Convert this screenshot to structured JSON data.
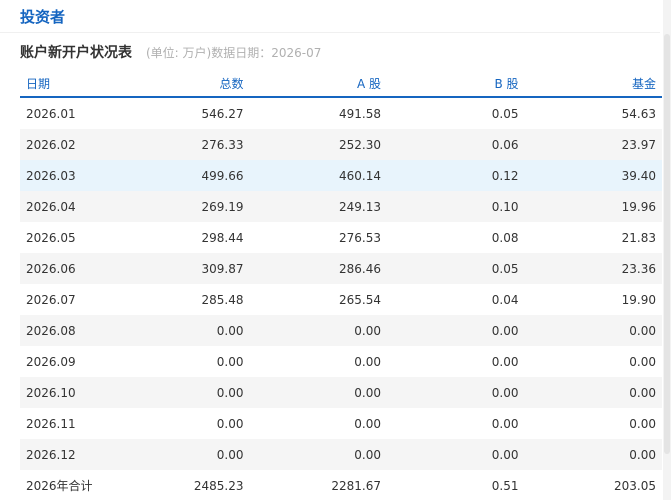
{
  "page": {
    "title": "投资者"
  },
  "section": {
    "title": "账户新开户状况表",
    "note": "(单位: 万户)数据日期：2026-07"
  },
  "table": {
    "headers": [
      "日期",
      "总数",
      "A 股",
      "B 股",
      "基金"
    ],
    "rows": [
      [
        "2026.01",
        "546.27",
        "491.58",
        "0.05",
        "54.63"
      ],
      [
        "2026.02",
        "276.33",
        "252.30",
        "0.06",
        "23.97"
      ],
      [
        "2026.03",
        "499.66",
        "460.14",
        "0.12",
        "39.40"
      ],
      [
        "2026.04",
        "269.19",
        "249.13",
        "0.10",
        "19.96"
      ],
      [
        "2026.05",
        "298.44",
        "276.53",
        "0.08",
        "21.83"
      ],
      [
        "2026.06",
        "309.87",
        "286.46",
        "0.05",
        "23.36"
      ],
      [
        "2026.07",
        "285.48",
        "265.54",
        "0.04",
        "19.90"
      ],
      [
        "2026.08",
        "0.00",
        "0.00",
        "0.00",
        "0.00"
      ],
      [
        "2026.09",
        "0.00",
        "0.00",
        "0.00",
        "0.00"
      ],
      [
        "2026.10",
        "0.00",
        "0.00",
        "0.00",
        "0.00"
      ],
      [
        "2026.11",
        "0.00",
        "0.00",
        "0.00",
        "0.00"
      ],
      [
        "2026.12",
        "0.00",
        "0.00",
        "0.00",
        "0.00"
      ],
      [
        "2026年合计",
        "2485.23",
        "2281.67",
        "0.51",
        "203.05"
      ]
    ]
  },
  "colors": {
    "accent": "#1565c0",
    "row_alt": "#f5f5f5",
    "row_highlight": "#e8f4fc"
  }
}
